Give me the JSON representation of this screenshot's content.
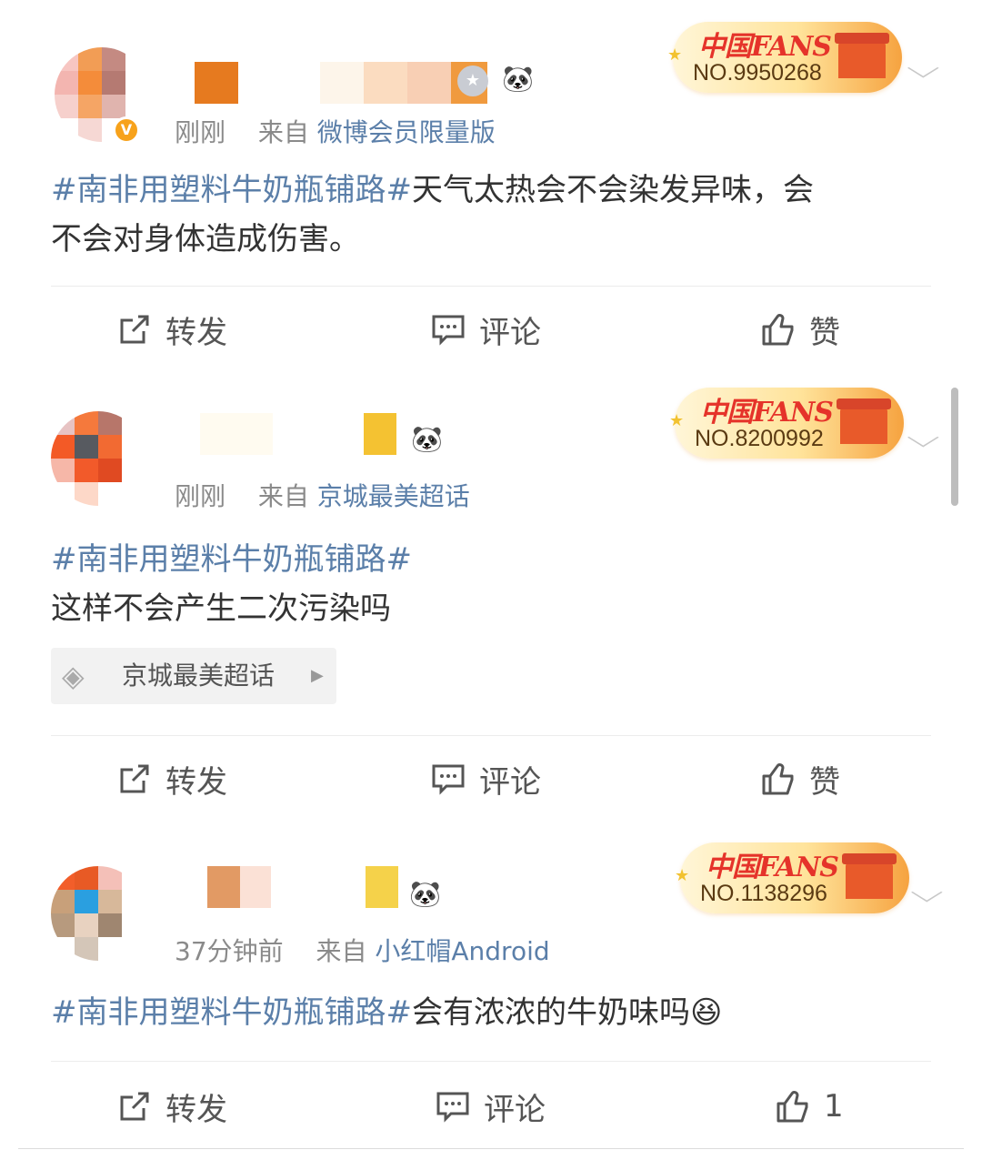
{
  "posts": [
    {
      "time": "刚刚",
      "source_prefix": "来自",
      "source": "微博会员限量版",
      "fans_no": "NO.9950268",
      "fans_logo": "中国FANS",
      "topic": "#南非用塑料牛奶瓶铺路#",
      "body_lines": [
        "天气太热会不会染发异味，会",
        "不会对身体造成伤害。"
      ],
      "chip": null,
      "actions": {
        "repost": "转发",
        "comment": "评论",
        "like": "赞"
      }
    },
    {
      "time": "刚刚",
      "source_prefix": "来自",
      "source": "京城最美超话",
      "fans_no": "NO.8200992",
      "fans_logo": "中国FANS",
      "topic": "#南非用塑料牛奶瓶铺路#",
      "body_lines": [
        "这样不会产生二次污染吗"
      ],
      "chip": "京城最美超话",
      "actions": {
        "repost": "转发",
        "comment": "评论",
        "like": "赞"
      }
    },
    {
      "time": "37分钟前",
      "source_prefix": "来自",
      "source": "小红帽Android",
      "fans_no": "NO.1138296",
      "fans_logo": "中国FANS",
      "topic": "#南非用塑料牛奶瓶铺路#",
      "body_lines": [
        "会有浓浓的牛奶味吗"
      ],
      "emoji": "😆",
      "chip": null,
      "actions": {
        "repost": "转发",
        "comment": "评论",
        "like": "1"
      }
    }
  ],
  "colors": {
    "link": "#5b7fa9",
    "meta": "#8a8a8a",
    "text": "#333333"
  }
}
